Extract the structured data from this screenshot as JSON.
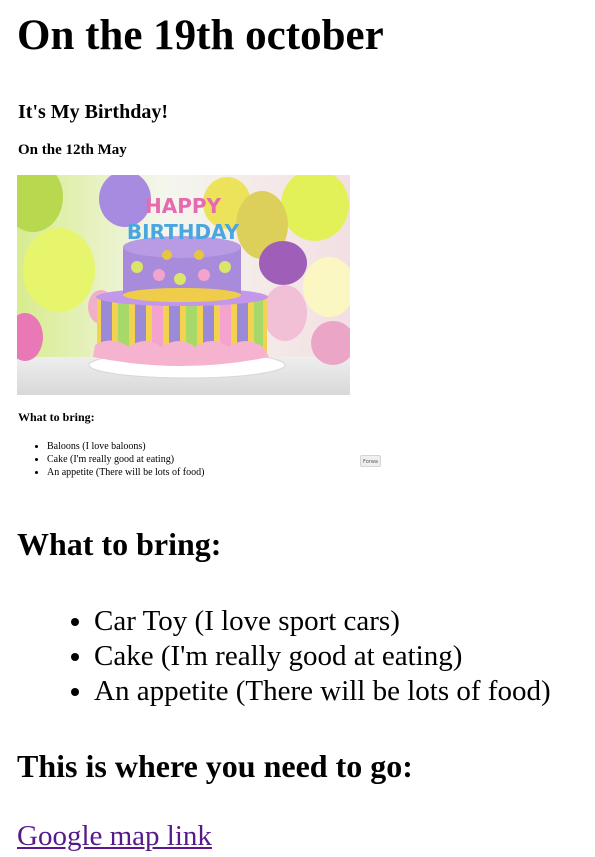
{
  "page": {
    "title": "On the 19th october",
    "embedded_screenshot": {
      "title": "It's My Birthday!",
      "subtitle": "On the 12th May",
      "image": {
        "banner_top": "HAPPY",
        "banner_bottom": "BIRTHDAY"
      },
      "bring_heading": "What to bring:",
      "bring_items": [
        "Baloons (I love baloons)",
        "Cake (I'm really good at eating)",
        "An appetite (There will be lots of food)"
      ],
      "button_label": "Forwa"
    },
    "bring_heading": "What to bring:",
    "bring_items": [
      "Car Toy (I love sport cars)",
      "Cake (I'm really good at eating)",
      "An appetite (There will be lots of food)"
    ],
    "go_heading": "This is where you need to go:",
    "map_link": "Google map link"
  }
}
